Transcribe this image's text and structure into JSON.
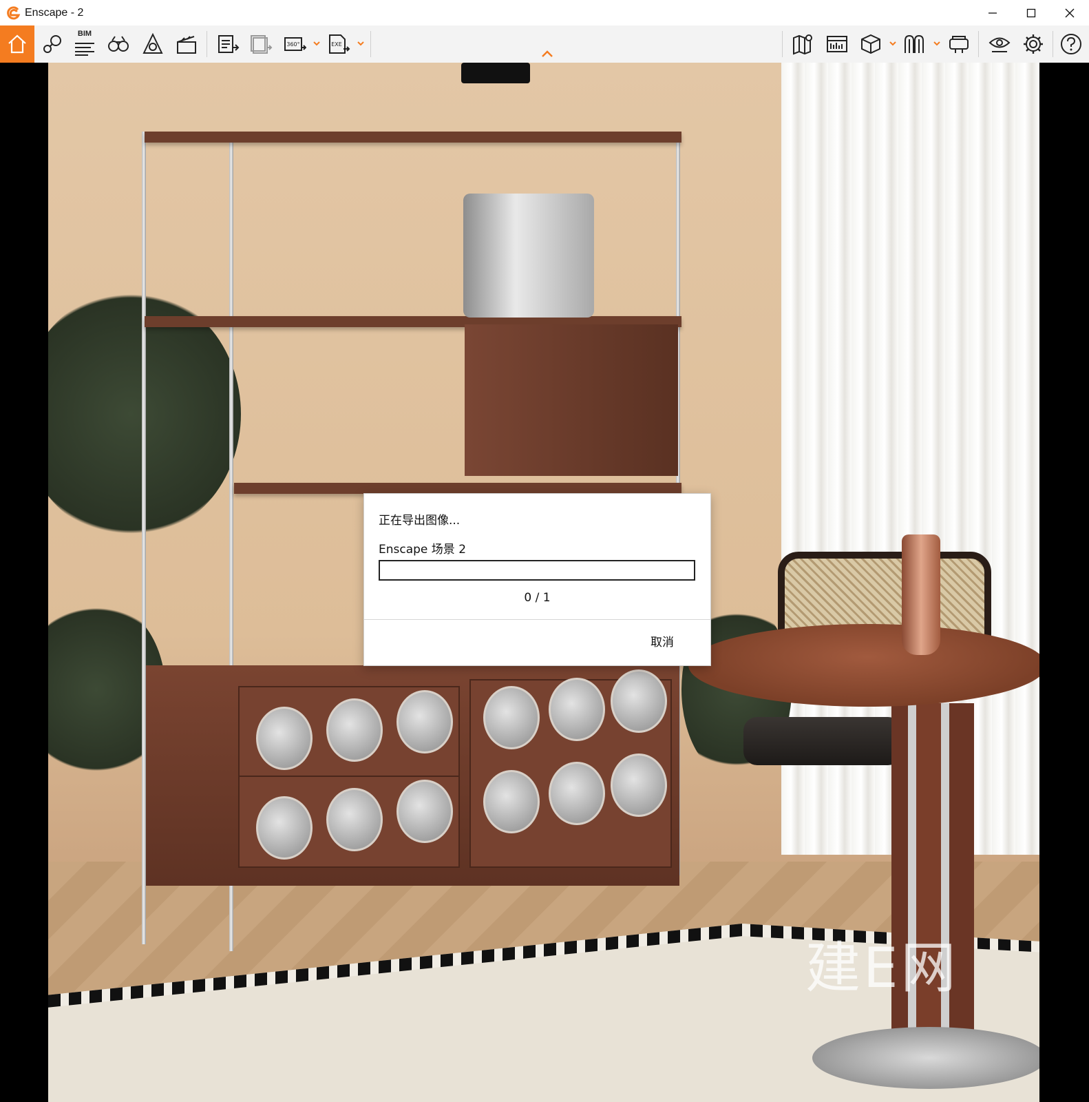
{
  "window": {
    "title": "Enscape - 2",
    "accent_color": "#f47c20"
  },
  "toolbar": {
    "left_buttons": [
      {
        "name": "home",
        "icon": "home-icon"
      },
      {
        "name": "asset-library",
        "icon": "key-search-icon"
      },
      {
        "name": "bim",
        "icon": "bim-list-icon",
        "label": "BIM"
      },
      {
        "name": "binoculars",
        "icon": "binoculars-icon"
      },
      {
        "name": "site-context",
        "icon": "compass-icon"
      },
      {
        "name": "video-editor",
        "icon": "clapperboard-icon"
      },
      {
        "name": "render-image",
        "icon": "render-image-icon"
      },
      {
        "name": "batch-render",
        "icon": "batch-render-icon"
      },
      {
        "name": "panorama",
        "icon": "panorama-360-icon",
        "label": "360°"
      },
      {
        "name": "export-exe",
        "icon": "export-exe-icon",
        "label": "EXE"
      }
    ],
    "right_buttons": [
      {
        "name": "map",
        "icon": "map-pin-icon"
      },
      {
        "name": "views",
        "icon": "views-panel-icon"
      },
      {
        "name": "cube",
        "icon": "cube-icon"
      },
      {
        "name": "collaborate",
        "icon": "collaborate-icon"
      },
      {
        "name": "vr-headset",
        "icon": "vr-headset-icon"
      },
      {
        "name": "visual-settings",
        "icon": "eye-settings-icon"
      },
      {
        "name": "settings",
        "icon": "gear-icon"
      },
      {
        "name": "help",
        "icon": "help-icon"
      }
    ]
  },
  "viewport": {
    "watermark": "建E网"
  },
  "export_dialog": {
    "title": "正在导出图像...",
    "scene_name": "Enscape 场景 2",
    "progress": 0,
    "counter": "0 / 1",
    "cancel_label": "取消"
  }
}
